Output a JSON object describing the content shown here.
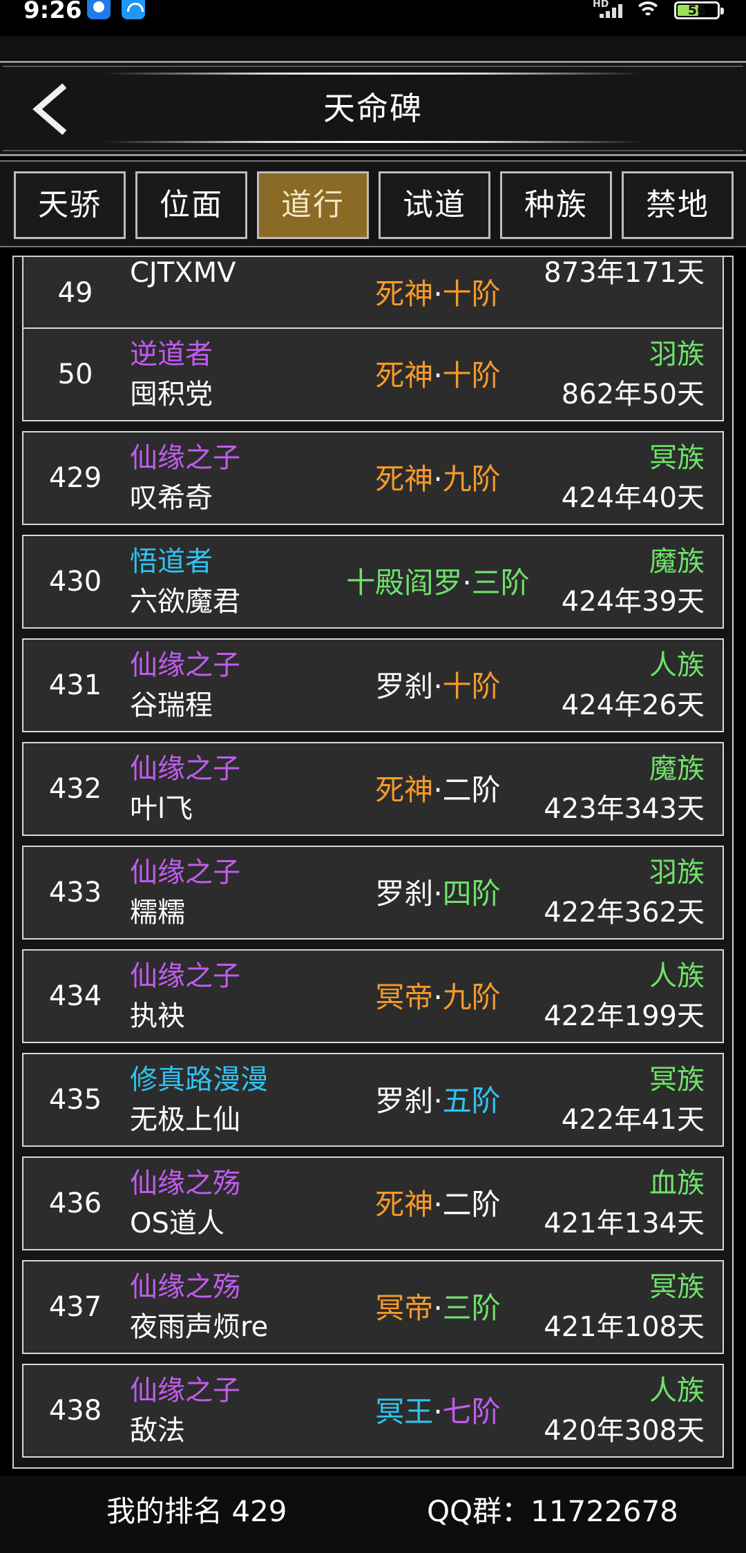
{
  "status_bar": {
    "time": "9:26",
    "battery": "56",
    "network": "HD"
  },
  "header": {
    "title": "天命碑"
  },
  "tabs": [
    {
      "label": "天骄",
      "active": false
    },
    {
      "label": "位面",
      "active": false
    },
    {
      "label": "道行",
      "active": true
    },
    {
      "label": "试道",
      "active": false
    },
    {
      "label": "种族",
      "active": false
    },
    {
      "label": "禁地",
      "active": false
    }
  ],
  "colors": {
    "active_tab": "#8b6a25",
    "title_purple": "#c25cf0",
    "title_cyan": "#2ec3f2",
    "realm_orange": "#f59a2a",
    "race_green": "#6fe26a"
  },
  "rows": [
    {
      "rank": "49",
      "title": "",
      "title_color": "purple",
      "name": "CJTXMV",
      "realm_name": "死神",
      "realm_name_color": "orange",
      "dot": "·",
      "realm_level": "十阶",
      "realm_level_color": "orange",
      "race": "",
      "age": "873年171天"
    },
    {
      "rank": "50",
      "title": "逆道者",
      "title_color": "purple",
      "name": "囤积党",
      "realm_name": "死神",
      "realm_name_color": "orange",
      "dot": "·",
      "realm_level": "十阶",
      "realm_level_color": "orange",
      "race": "羽族",
      "age": "862年50天"
    },
    {
      "rank": "429",
      "title": "仙缘之子",
      "title_color": "purple",
      "name": "叹希奇",
      "realm_name": "死神",
      "realm_name_color": "orange",
      "dot": "·",
      "realm_level": "九阶",
      "realm_level_color": "orange",
      "race": "冥族",
      "age": "424年40天"
    },
    {
      "rank": "430",
      "title": "悟道者",
      "title_color": "cyan",
      "name": "六欲魔君",
      "realm_name": "十殿阎罗",
      "realm_name_color": "green",
      "dot": "·",
      "realm_level": "三阶",
      "realm_level_color": "green",
      "race": "魔族",
      "age": "424年39天"
    },
    {
      "rank": "431",
      "title": "仙缘之子",
      "title_color": "purple",
      "name": "谷瑞程",
      "realm_name": "罗刹",
      "realm_name_color": "white",
      "dot": "·",
      "realm_level": "十阶",
      "realm_level_color": "orange",
      "race": "人族",
      "age": "424年26天"
    },
    {
      "rank": "432",
      "title": "仙缘之子",
      "title_color": "purple",
      "name": "叶l飞",
      "realm_name": "死神",
      "realm_name_color": "orange",
      "dot": "·",
      "realm_level": "二阶",
      "realm_level_color": "white",
      "race": "魔族",
      "age": "423年343天"
    },
    {
      "rank": "433",
      "title": "仙缘之子",
      "title_color": "purple",
      "name": "糯糯",
      "realm_name": "罗刹",
      "realm_name_color": "white",
      "dot": "·",
      "realm_level": "四阶",
      "realm_level_color": "green",
      "race": "羽族",
      "age": "422年362天"
    },
    {
      "rank": "434",
      "title": "仙缘之子",
      "title_color": "purple",
      "name": "执袂",
      "realm_name": "冥帝",
      "realm_name_color": "orange",
      "dot": "·",
      "realm_level": "九阶",
      "realm_level_color": "orange",
      "race": "人族",
      "age": "422年199天"
    },
    {
      "rank": "435",
      "title": "修真路漫漫",
      "title_color": "cyan",
      "name": "无极上仙",
      "realm_name": "罗刹",
      "realm_name_color": "white",
      "dot": "·",
      "realm_level": "五阶",
      "realm_level_color": "cyan",
      "race": "冥族",
      "age": "422年41天"
    },
    {
      "rank": "436",
      "title": "仙缘之殇",
      "title_color": "purple",
      "name": "OS道人",
      "realm_name": "死神",
      "realm_name_color": "orange",
      "dot": "·",
      "realm_level": "二阶",
      "realm_level_color": "white",
      "race": "血族",
      "age": "421年134天"
    },
    {
      "rank": "437",
      "title": "仙缘之殇",
      "title_color": "purple",
      "name": "夜雨声烦re",
      "realm_name": "冥帝",
      "realm_name_color": "orange",
      "dot": "·",
      "realm_level": "三阶",
      "realm_level_color": "green",
      "race": "冥族",
      "age": "421年108天"
    },
    {
      "rank": "438",
      "title": "仙缘之子",
      "title_color": "purple",
      "name": "敌法",
      "realm_name": "冥王",
      "realm_name_color": "cyan",
      "dot": "·",
      "realm_level": "七阶",
      "realm_level_color": "purple",
      "race": "人族",
      "age": "420年308天"
    }
  ],
  "footer": {
    "my_rank": "我的排名 429",
    "qq_group": "QQ群：11722678"
  }
}
